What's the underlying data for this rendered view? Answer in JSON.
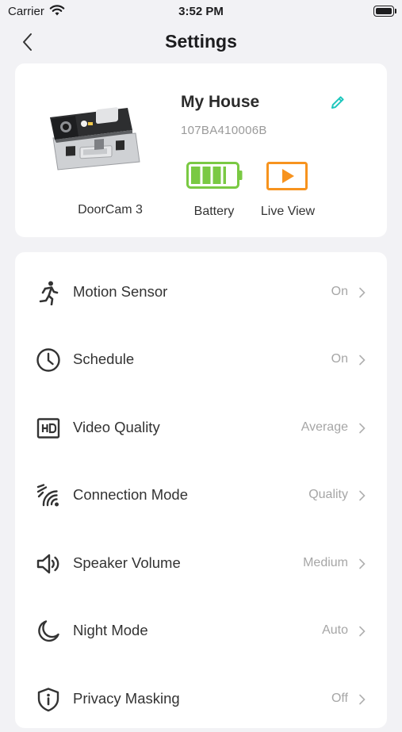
{
  "status_bar": {
    "carrier": "Carrier",
    "time": "3:52 PM"
  },
  "nav": {
    "title": "Settings"
  },
  "device": {
    "name": "My House",
    "serial": "107BA410006B",
    "model": "DoorCam 3",
    "battery_label": "Battery",
    "battery_level": 0.8,
    "live_view_label": "Live View",
    "colors": {
      "battery": "#7ac943",
      "live_view": "#f7931e",
      "edit": "#1fc7bd"
    }
  },
  "settings": [
    {
      "label": "Motion Sensor",
      "value": "On",
      "icon": "running-person-icon"
    },
    {
      "label": "Schedule",
      "value": "On",
      "icon": "clock-icon"
    },
    {
      "label": "Video Quality",
      "value": "Average",
      "icon": "hd-icon"
    },
    {
      "label": "Connection Mode",
      "value": "Quality",
      "icon": "signal-waves-icon"
    },
    {
      "label": "Speaker Volume",
      "value": "Medium",
      "icon": "speaker-icon"
    },
    {
      "label": "Night Mode",
      "value": "Auto",
      "icon": "moon-icon"
    },
    {
      "label": "Privacy Masking",
      "value": "Off",
      "icon": "shield-info-icon"
    }
  ]
}
